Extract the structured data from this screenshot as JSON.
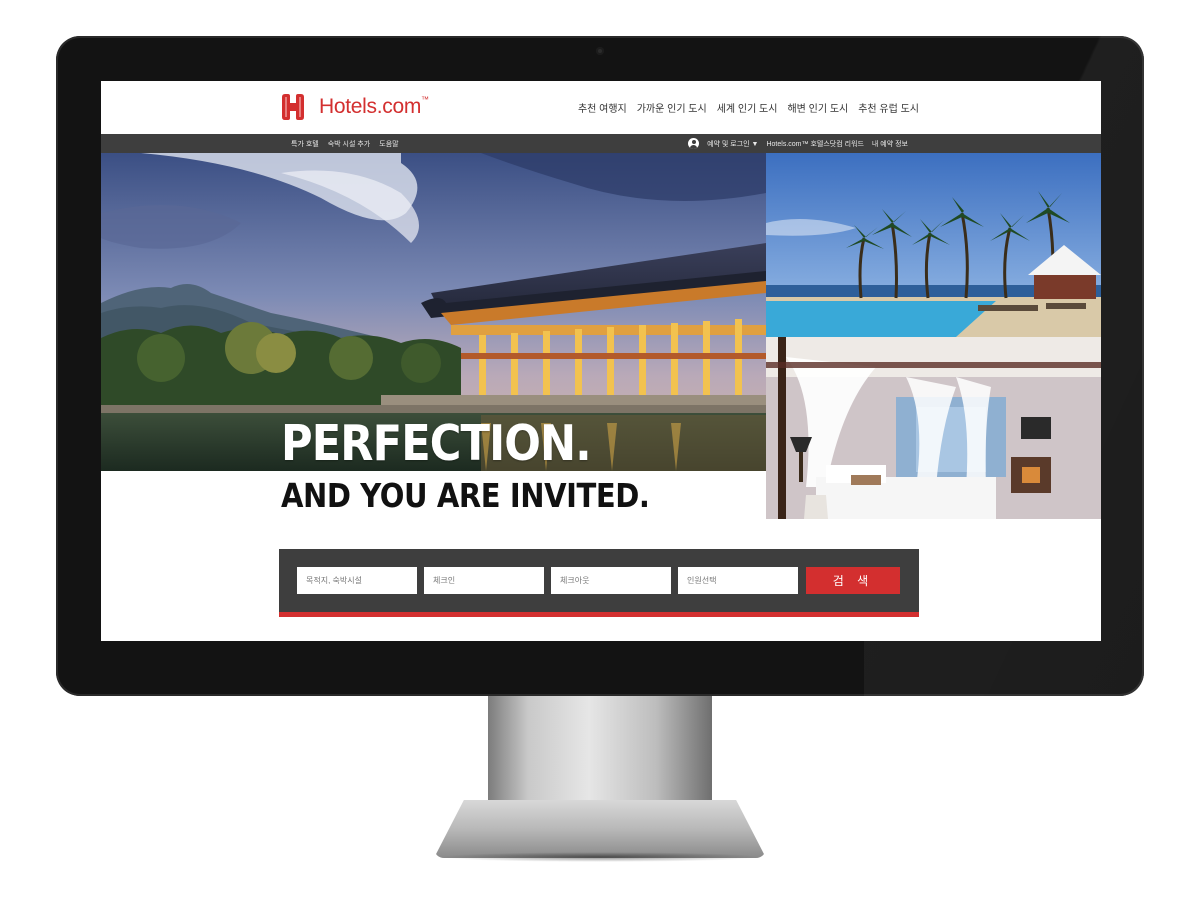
{
  "brand": {
    "name": "Hotels.com",
    "trademark": "™",
    "color": "#d32f2f"
  },
  "topnav": {
    "items": [
      {
        "label": "추천 여행지"
      },
      {
        "label": "가까운 인기 도시"
      },
      {
        "label": "세계 인기 도시"
      },
      {
        "label": "해변 인기 도시"
      },
      {
        "label": "추천 유럽 도시"
      }
    ]
  },
  "subbar": {
    "left_items": [
      {
        "label": "특가 호텔"
      },
      {
        "label": "숙박 시설 추가"
      },
      {
        "label": "도움말"
      }
    ],
    "account_label": "예약 및 로그인 ▼",
    "rewards_label": "Hotels.com™ 호텔스닷컴 리워드",
    "my_booking_label": "내 예약 정보"
  },
  "hero": {
    "headline_line1": "PERFECTION.",
    "headline_line2": "AND YOU ARE INVITED."
  },
  "search": {
    "destination_placeholder": "목적지, 숙박시설",
    "checkin_placeholder": "체크인",
    "checkout_placeholder": "체크아웃",
    "guests_placeholder": "인원선택",
    "button_label": "검 색"
  },
  "colors": {
    "accent": "#d32f2f",
    "bar": "#3e3e3e"
  }
}
